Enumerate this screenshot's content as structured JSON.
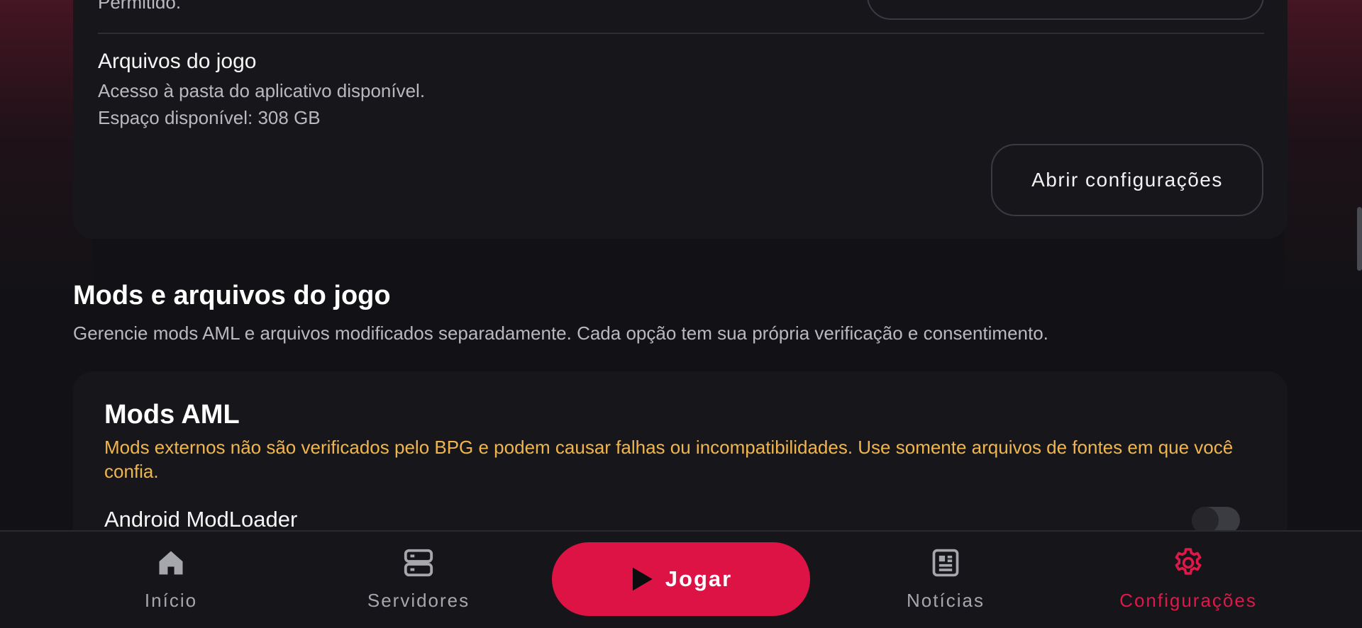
{
  "top_card": {
    "partial_text": "Permitido.",
    "partial_button_label": "",
    "game_files": {
      "title": "Arquivos do jogo",
      "line1": "Acesso à pasta do aplicativo disponível.",
      "line2": "Espaço disponível: 308 GB",
      "button_label": "Abrir configurações"
    }
  },
  "mods_section": {
    "title": "Mods e arquivos do jogo",
    "description": "Gerencie mods AML e arquivos modificados separadamente. Cada opção tem sua própria verificação e consentimento."
  },
  "aml_card": {
    "title": "Mods AML",
    "warning": "Mods externos não são verificados pelo BPG e podem causar falhas ou incompatibilidades. Use somente arquivos de fontes em que você confia.",
    "items": [
      {
        "label": "Android ModLoader",
        "enabled": false
      }
    ]
  },
  "bottom_nav": {
    "items": [
      {
        "label": "Início",
        "icon": "home-icon"
      },
      {
        "label": "Servidores",
        "icon": "servers-icon"
      },
      {
        "label": "Notícias",
        "icon": "news-icon"
      },
      {
        "label": "Configurações",
        "icon": "gear-icon",
        "active": true
      }
    ],
    "play_button": {
      "label": "Jogar",
      "icon": "play-icon"
    }
  },
  "colors": {
    "accent": "#dd1346",
    "warning": "#f0b54d",
    "background": "#121216",
    "card": "#17171b"
  }
}
